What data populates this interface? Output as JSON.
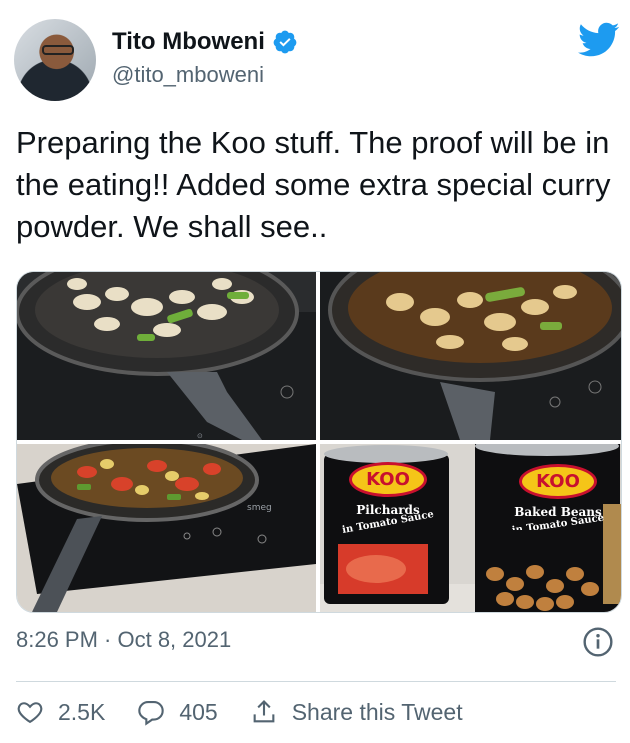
{
  "author": {
    "name": "Tito Mboweni",
    "handle": "@tito_mboweni",
    "verified": true
  },
  "tweet": {
    "text": "Preparing the Koo stuff. The proof will be in the eating!! Added some extra special curry powder. We shall see.."
  },
  "media": {
    "can_labels": [
      {
        "brand": "KOO",
        "product": "Pilchards",
        "sub": "in Tomato Sauce"
      },
      {
        "brand": "KOO",
        "product": "Baked Beans",
        "sub": "in Tomato Sauce"
      }
    ],
    "stove_brand": "smeg"
  },
  "meta": {
    "timestamp": "8:26 PM · Oct 8, 2021"
  },
  "actions": {
    "likes": "2.5K",
    "replies": "405",
    "share_label": "Share this Tweet"
  },
  "colors": {
    "twitter_blue": "#1d9bf0",
    "text_primary": "#0f1419",
    "text_secondary": "#536471"
  },
  "icons": [
    "verified-badge-icon",
    "twitter-bird-icon",
    "info-icon",
    "heart-icon",
    "reply-icon",
    "share-icon"
  ]
}
